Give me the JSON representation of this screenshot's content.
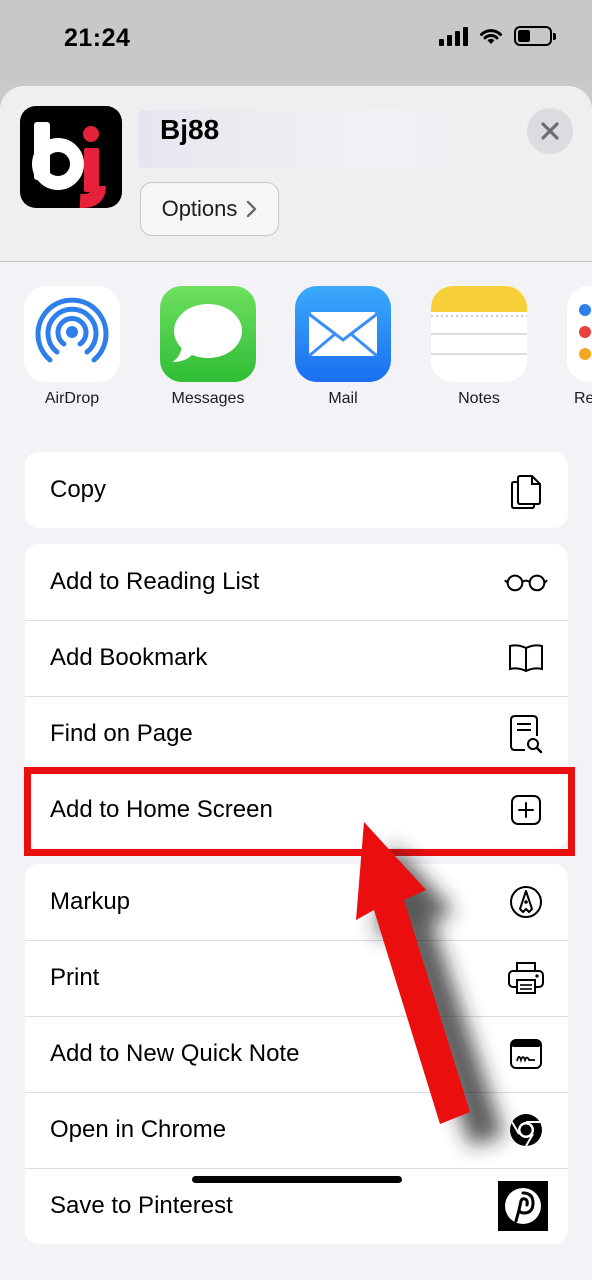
{
  "status_bar": {
    "time": "21:24"
  },
  "header": {
    "site_title": "Bj88",
    "options_label": "Options",
    "options_chevron": ">",
    "logo_text": "bj"
  },
  "share_apps": [
    {
      "label": "AirDrop",
      "icon": "airdrop-icon"
    },
    {
      "label": "Messages",
      "icon": "messages-icon"
    },
    {
      "label": "Mail",
      "icon": "mail-icon"
    },
    {
      "label": "Notes",
      "icon": "notes-icon"
    },
    {
      "label": "Re",
      "icon": "reminders-icon"
    }
  ],
  "actions": {
    "group1": [
      {
        "label": "Copy",
        "icon": "copy-icon"
      }
    ],
    "group2": [
      {
        "label": "Add to Reading List",
        "icon": "glasses-icon"
      },
      {
        "label": "Add Bookmark",
        "icon": "book-icon"
      },
      {
        "label": "Find on Page",
        "icon": "find-document-icon"
      },
      {
        "label": "Add to Home Screen",
        "icon": "plus-square-icon"
      }
    ],
    "group3": [
      {
        "label": "Markup",
        "icon": "markup-pen-icon"
      },
      {
        "label": "Print",
        "icon": "printer-icon"
      },
      {
        "label": "Add to New Quick Note",
        "icon": "quick-note-icon"
      },
      {
        "label": "Open in Chrome",
        "icon": "chrome-icon"
      },
      {
        "label": "Save to Pinterest",
        "icon": "pinterest-icon"
      }
    ]
  },
  "colors": {
    "highlight": "#ea0e0e",
    "sheet_bg": "#f2f2f7",
    "mail_blue": "#1e8cf4",
    "messages_green": "#34c759",
    "airdrop_blue": "#2f7fea"
  }
}
